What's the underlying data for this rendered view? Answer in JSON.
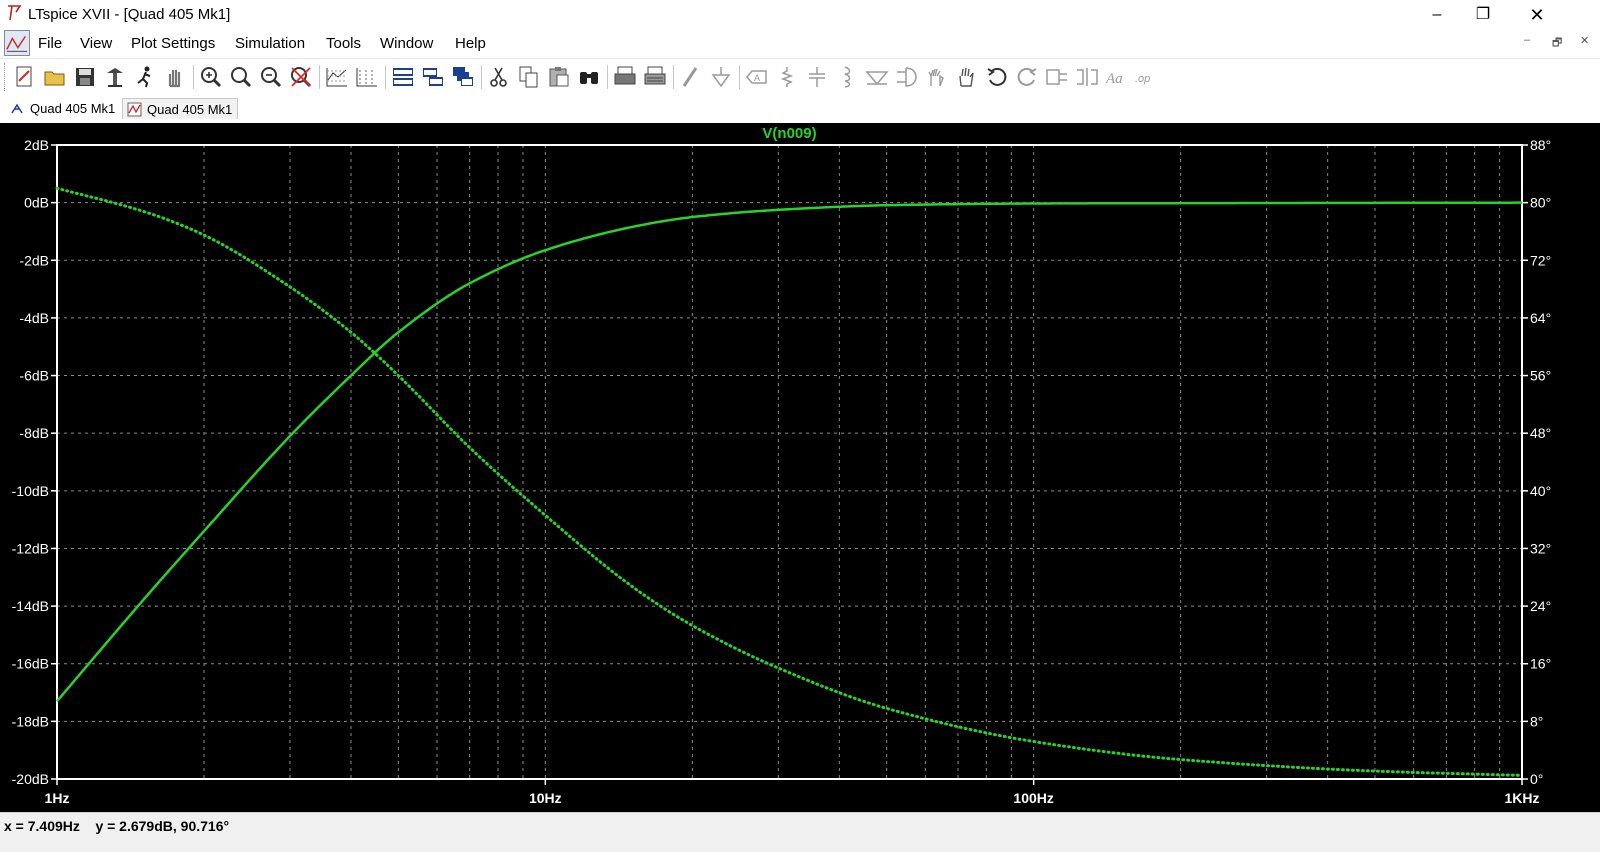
{
  "window": {
    "title": "LTspice XVII - [Quad 405 Mk1]",
    "controls": {
      "minimize": "–",
      "maximize": "❐",
      "close": "✕"
    }
  },
  "menu": [
    {
      "label": "File",
      "mnemonic": "F"
    },
    {
      "label": "View",
      "mnemonic": "V"
    },
    {
      "label": "Plot Settings",
      "mnemonic": "P"
    },
    {
      "label": "Simulation",
      "mnemonic": "S"
    },
    {
      "label": "Tools",
      "mnemonic": "T"
    },
    {
      "label": "Window",
      "mnemonic": "W"
    },
    {
      "label": "Help",
      "mnemonic": "H"
    }
  ],
  "mdi_controls": {
    "minimize": "–",
    "restore": "🗗",
    "close": "✕"
  },
  "toolbar_icons": [
    "new-schematic-icon",
    "open-icon",
    "save-icon",
    "control-panel-icon",
    "run-icon",
    "halt-icon",
    "zoom-in-icon",
    "zoom-fit-icon",
    "zoom-out-icon",
    "zoom-cancel-icon",
    "autorange-icon",
    "mark-icon",
    "tile-horizontal-icon",
    "tile-vertical-icon",
    "cascade-icon",
    "cut-icon",
    "copy-icon",
    "paste-icon",
    "find-icon",
    "print-icon",
    "print-setup-icon",
    "wire-icon",
    "ground-icon",
    "label-net-icon",
    "resistor-icon",
    "capacitor-icon",
    "inductor-icon",
    "diode-icon",
    "component-icon",
    "move-icon",
    "drag-icon",
    "undo-icon",
    "redo-icon",
    "rotate-icon",
    "mirror-icon",
    "text-icon",
    "spice-directive-icon"
  ],
  "tabs": [
    {
      "label": "Quad 405 Mk1",
      "kind": "schematic",
      "active": false
    },
    {
      "label": "Quad 405 Mk1",
      "kind": "waveform",
      "active": true
    }
  ],
  "chart_data": {
    "type": "line",
    "title": "V(n009)",
    "xscale": "log",
    "xlim": [
      1,
      1000
    ],
    "x_ticks": [
      "1Hz",
      "10Hz",
      "100Hz",
      "1KHz"
    ],
    "y_left": {
      "ylim": [
        -20,
        2
      ],
      "unit": "dB",
      "ticks": [
        "2dB",
        "0dB",
        "-2dB",
        "-4dB",
        "-6dB",
        "-8dB",
        "-10dB",
        "-12dB",
        "-14dB",
        "-16dB",
        "-18dB",
        "-20dB"
      ]
    },
    "y_right": {
      "ylim": [
        0,
        88
      ],
      "unit": "°",
      "ticks": [
        "88°",
        "80°",
        "72°",
        "64°",
        "56°",
        "48°",
        "40°",
        "32°",
        "24°",
        "16°",
        "8°",
        "0°"
      ]
    },
    "grid": true,
    "colors": {
      "background": "#000000",
      "trace": "#2bd12b",
      "grid": "#8a8a8a",
      "axis": "#ffffff",
      "text": "#ffffff",
      "title": "#2bd12b"
    },
    "series": [
      {
        "axis": "left",
        "style": "solid",
        "x": [
          1,
          1.5,
          2,
          3,
          4,
          5,
          7,
          10,
          15,
          20,
          30,
          50,
          100,
          1000
        ],
        "y": [
          -17.3,
          -13.8,
          -11.4,
          -8.1,
          -6.0,
          -4.5,
          -2.8,
          -1.65,
          -0.85,
          -0.5,
          -0.25,
          -0.09,
          -0.03,
          0.0
        ]
      },
      {
        "axis": "right",
        "style": "dotted",
        "x": [
          1,
          1.5,
          2,
          3,
          4,
          5,
          7,
          10,
          15,
          20,
          30,
          50,
          100,
          200,
          500,
          1000
        ],
        "y": [
          82.0,
          78.8,
          75.5,
          68.3,
          62.0,
          56.0,
          46.0,
          36.6,
          26.8,
          21.3,
          15.4,
          9.8,
          5.2,
          2.7,
          1.1,
          0.5
        ]
      }
    ]
  },
  "status": "x = 7.409Hz    y = 2.679dB, 90.716°"
}
